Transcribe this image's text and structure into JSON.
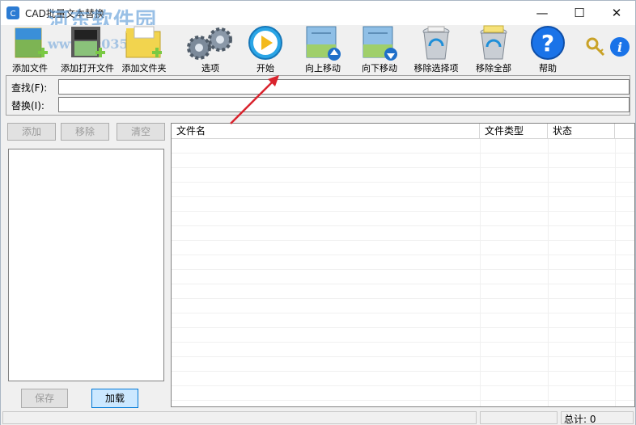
{
  "window": {
    "title": "CAD批量文本替换",
    "watermark": "河东软件园",
    "watermark_url": "www.pc0359.cn",
    "min_glyph": "—",
    "max_glyph": "☐",
    "close_glyph": "✕"
  },
  "toolbar": {
    "add_file": "添加文件",
    "add_open_file": "添加打开文件",
    "add_folder": "添加文件夹",
    "options": "选项",
    "start": "开始",
    "move_up": "向上移动",
    "move_down": "向下移动",
    "remove_selected": "移除选择项",
    "remove_all": "移除全部",
    "help": "帮助"
  },
  "fields": {
    "find_label": "查找(F):",
    "find_value": "",
    "replace_label": "替换(I):",
    "replace_value": ""
  },
  "left_panel": {
    "add": "添加",
    "remove": "移除",
    "clear": "清空",
    "save": "保存",
    "load": "加载"
  },
  "table": {
    "columns": [
      "文件名",
      "文件类型",
      "状态"
    ],
    "rows": []
  },
  "status": {
    "total_label": "总计: 0"
  },
  "colors": {
    "accent": "#0078d7",
    "arrow": "#d9232d",
    "help_blue": "#1a73e8"
  }
}
